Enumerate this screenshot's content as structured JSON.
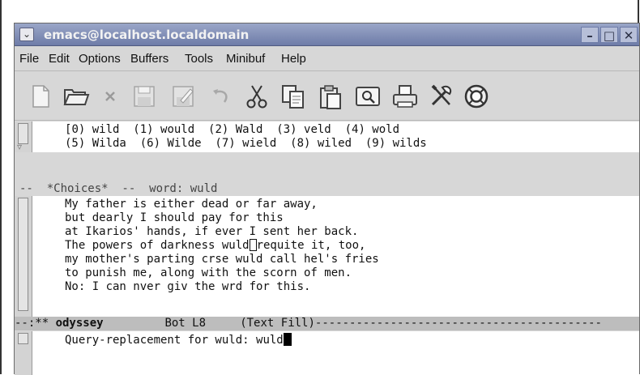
{
  "window": {
    "title": "emacs@localhost.localdomain",
    "menu_button": "⌄",
    "controls": {
      "minimize": "–",
      "maximize": "□",
      "close": "✕"
    }
  },
  "menubar": {
    "items": [
      "File",
      "Edit",
      "Options",
      "Buffers",
      "Tools",
      "Minibuf",
      "Help"
    ]
  },
  "toolbar": {
    "icons": [
      "new-file-icon",
      "open-folder-icon",
      "close-x-icon",
      "save-icon",
      "save-as-icon",
      "undo-icon",
      "cut-icon",
      "copy-icon",
      "paste-icon",
      "search-icon",
      "print-icon",
      "tools-icon",
      "help-icon"
    ]
  },
  "choices_pane": {
    "line1_cursor": "[",
    "line1_rest": "0) wild  (1) would  (2) Wald  (3) veld  (4) wold",
    "line2": "(5) Wilda  (6) Wilde  (7) wield  (8) wiled  (9) wilds",
    "modeline": "--  *Choices*  --  word: wuld"
  },
  "text_pane": {
    "lines": [
      "My father is either dead or far away,",
      "but dearly I should pay for this",
      "at Ikarios' hands, if ever I sent her back.",
      "The powers of darkness wuld",
      "my mother's parting crse wuld call hel's fries",
      "to punish me, along with the scorn of men.",
      "No: I can nver giv the wrd for this."
    ],
    "line4_after_cursor": "requite it, too,",
    "modeline_prefix": "--:** ",
    "buffer_name": "odyssey",
    "position": "Bot L8",
    "mode": "(Text Fill)",
    "modeline_fill": "------------------------------------------"
  },
  "minibuffer": {
    "prompt": "Query-replacement for wuld: ",
    "input": "wuld"
  }
}
